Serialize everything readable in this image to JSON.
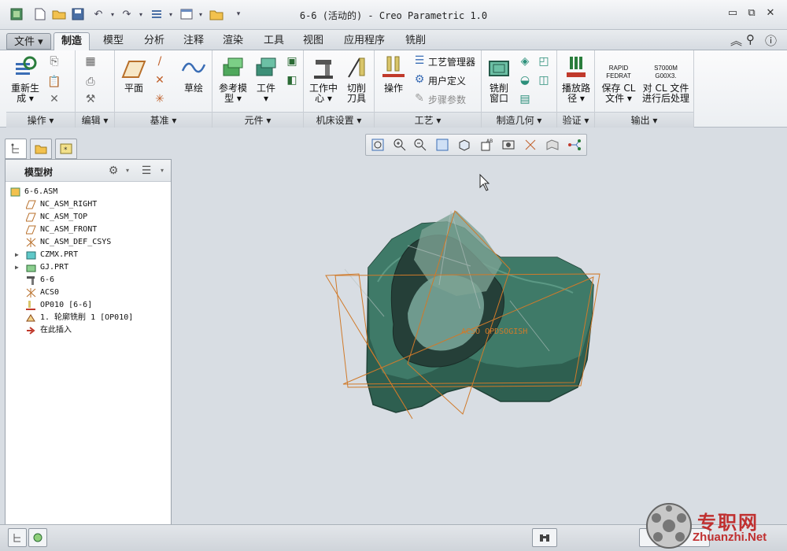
{
  "window": {
    "title": "6-6 (活动的) - Creo Parametric 1.0"
  },
  "quick_access": {
    "icons": [
      "model-icon",
      "new-icon",
      "open-icon",
      "save-icon",
      "undo-icon",
      "redo-icon",
      "regenerate-icon",
      "windows-icon",
      "folder-icon",
      "customize-icon"
    ]
  },
  "menu_tabs": [
    "文件 ▾",
    "制造",
    "模型",
    "分析",
    "注释",
    "渲染",
    "工具",
    "视图",
    "应用程序",
    "铣削"
  ],
  "active_tab": "制造",
  "ribbon": {
    "groups": [
      "操作 ▾",
      "编辑 ▾",
      "基准 ▾",
      "元件 ▾",
      "机床设置 ▾",
      "工艺 ▾",
      "制造几何 ▾",
      "验证 ▾",
      "输出 ▾"
    ],
    "regenerate": [
      "重新生",
      "成 ▾"
    ],
    "plane": "平面",
    "sketch": "草绘",
    "ref_model": [
      "参考模",
      "型 ▾"
    ],
    "workpiece": [
      "工件",
      "▾"
    ],
    "work_center": [
      "工作中",
      "心 ▾"
    ],
    "cutter": [
      "切削",
      "刀具"
    ],
    "operation": "操作",
    "process_manager": "工艺管理器",
    "user_defined": "用户定义",
    "step_params": "步骤参数",
    "mill_window": [
      "铣削",
      "窗口"
    ],
    "play_path": [
      "播放路",
      "径 ▾"
    ],
    "save_cl": [
      "保存 CL",
      "文件 ▾"
    ],
    "post_cl": [
      "对 CL 文件",
      "进行后处理"
    ],
    "rapid": [
      "RAPID",
      "FEDRAT"
    ],
    "s7000": [
      "S7000M",
      "G00X3."
    ]
  },
  "panel": {
    "title": "模型树",
    "tree": [
      {
        "label": "6-6.ASM"
      },
      {
        "label": "NC_ASM_RIGHT"
      },
      {
        "label": "NC_ASM_TOP"
      },
      {
        "label": "NC_ASM_FRONT"
      },
      {
        "label": "NC_ASM_DEF_CSYS"
      },
      {
        "label": "CZMX.PRT"
      },
      {
        "label": "GJ.PRT"
      },
      {
        "label": "6-6"
      },
      {
        "label": "ACS0"
      },
      {
        "label": "OP010 [6-6]"
      },
      {
        "label": "1. 轮廓铣削 1 [OP010]"
      },
      {
        "label": "在此插入"
      }
    ]
  },
  "canvas": {
    "annotation": "ACSO OPDSOGISH"
  },
  "watermark": {
    "text": "专职网",
    "url": "Zhuanzhi.Net"
  },
  "colors": {
    "accent": "#2f5da8",
    "model_green": "#3f7a68",
    "datum_orange": "#d07a2a"
  }
}
